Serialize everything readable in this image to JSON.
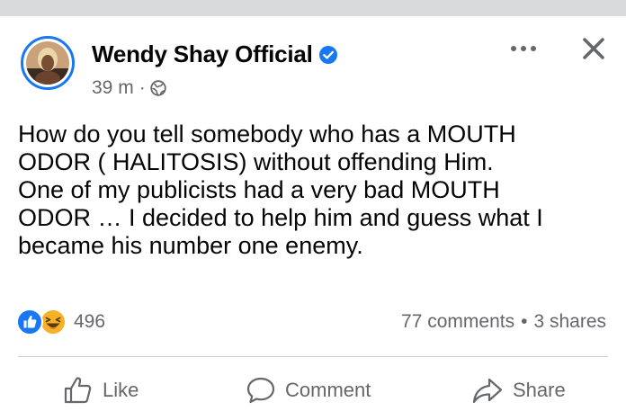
{
  "post": {
    "author": "Wendy Shay Official",
    "time": "39 m",
    "meta_separator": "·",
    "text_lines": [
      "How do you tell somebody who has a MOUTH",
      "ODOR ( HALITOSIS) without offending Him.",
      "One of my publicists had a very bad MOUTH",
      "ODOR … I decided to help him and guess what I",
      "became his number one enemy."
    ],
    "reaction_count": "496",
    "comments": "77 comments",
    "engagement_separator": "•",
    "shares": "3 shares"
  },
  "actions": {
    "like": "Like",
    "comment": "Comment",
    "share": "Share"
  },
  "icons": {
    "verified": "verified-badge-icon",
    "globe": "globe-icon",
    "more": "more-horizontal-icon",
    "close": "close-icon",
    "like_reaction": "like-reaction-icon",
    "haha_reaction": "haha-reaction-icon",
    "like_action": "thumbs-up-icon",
    "comment_action": "comment-bubble-icon",
    "share_action": "share-arrow-icon"
  },
  "colors": {
    "brand_blue": "#1877f2",
    "text_primary": "#050505",
    "text_secondary": "#65676b",
    "divider": "#ced0d4",
    "haha_yellow": "#f7b125"
  }
}
